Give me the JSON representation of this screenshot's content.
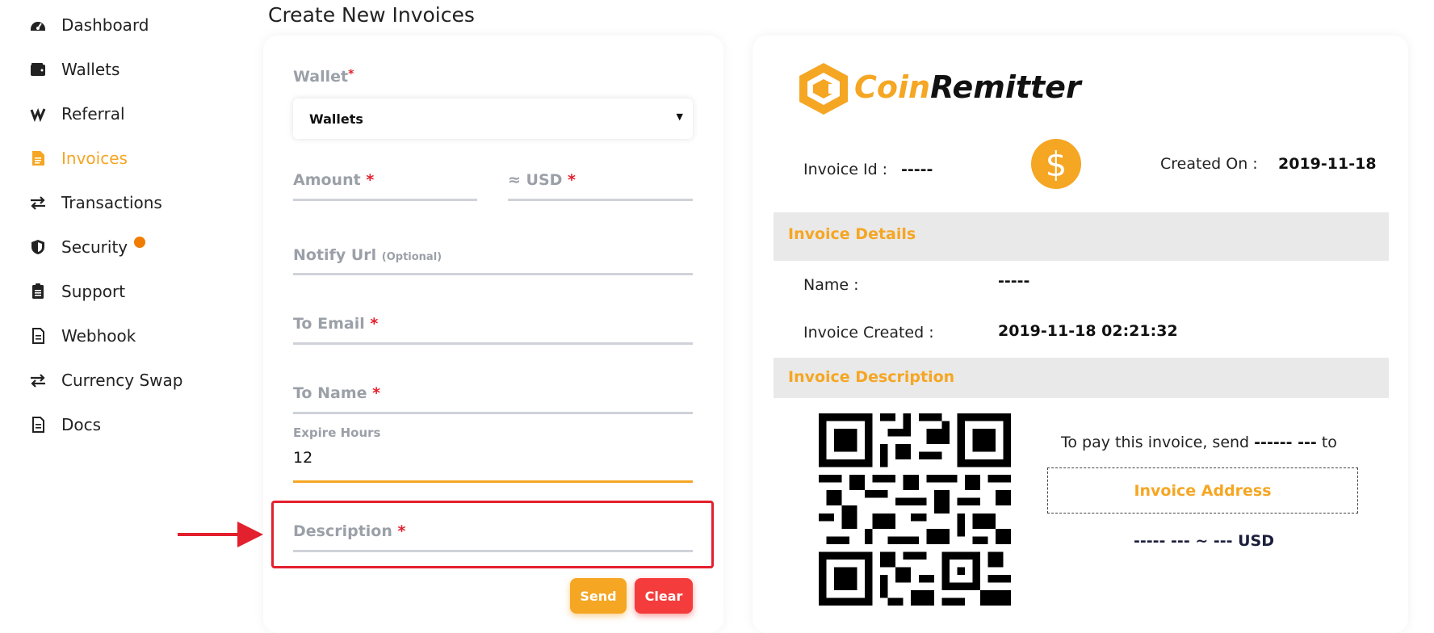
{
  "sidebar": {
    "items": [
      {
        "label": "Dashboard",
        "icon": "dashboard-icon"
      },
      {
        "label": "Wallets",
        "icon": "wallet-icon"
      },
      {
        "label": "Referral",
        "icon": "referral-icon"
      },
      {
        "label": "Invoices",
        "icon": "invoice-icon",
        "active": true
      },
      {
        "label": "Transactions",
        "icon": "transactions-icon"
      },
      {
        "label": "Security",
        "icon": "shield-icon",
        "badge": true
      },
      {
        "label": "Support",
        "icon": "support-icon"
      },
      {
        "label": "Webhook",
        "icon": "webhook-icon"
      },
      {
        "label": "Currency Swap",
        "icon": "swap-icon"
      },
      {
        "label": "Docs",
        "icon": "docs-icon"
      }
    ]
  },
  "page": {
    "title": "Create New Invoices"
  },
  "form": {
    "wallet_label": "Wallet",
    "wallet_required": "*",
    "wallet_selected": "Wallets",
    "amount_label": "Amount",
    "usd_label": "≈ USD",
    "notify_label": "Notify Url",
    "notify_optional": "(Optional)",
    "email_label": "To Email",
    "name_label": "To Name",
    "expire_label": "Expire Hours",
    "expire_value": "12",
    "description_label": "Description",
    "required_mark": "*",
    "send_label": "Send",
    "clear_label": "Clear"
  },
  "invoice": {
    "brand_part1": "Coin",
    "brand_part2": "Remitter",
    "invoice_id_label": "Invoice Id :",
    "invoice_id_value": "-----",
    "coin_symbol": "$",
    "created_on_label": "Created On :",
    "created_on_value": "2019-11-18",
    "details_heading": "Invoice Details",
    "name_label": "Name :",
    "name_value": "-----",
    "invoice_created_label": "Invoice Created :",
    "invoice_created_value": "2019-11-18 02:21:32",
    "description_heading": "Invoice Description",
    "pay_prefix": "To pay this invoice, send",
    "pay_amount": "------ ---",
    "pay_suffix": "to",
    "address_label": "Invoice Address",
    "usd_line": "----- --- ~ --- USD"
  },
  "colors": {
    "accent": "#f5a623",
    "danger": "#e3202d",
    "badge": "#f07c00"
  }
}
